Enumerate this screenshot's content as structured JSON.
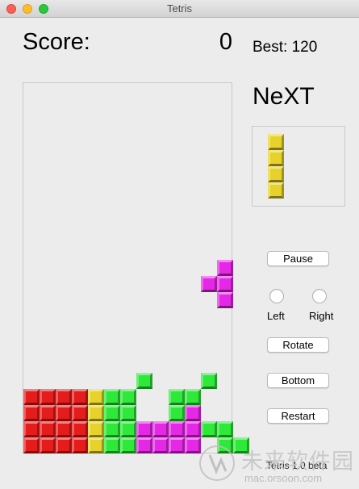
{
  "window": {
    "title": "Tetris"
  },
  "score": {
    "label": "Score:",
    "value": "0",
    "best": "Best: 120"
  },
  "next": {
    "title": "NeXT",
    "piece": {
      "color": "#e6d22a",
      "cells": [
        [
          0,
          0
        ],
        [
          0,
          1
        ],
        [
          0,
          2
        ],
        [
          0,
          3
        ]
      ]
    }
  },
  "controls": {
    "pause": "Pause",
    "left": "Left",
    "right": "Right",
    "rotate": "Rotate",
    "bottom": "Bottom",
    "restart": "Restart"
  },
  "footer": {
    "text": "Tetris 1.0 beta"
  },
  "watermark": {
    "site_name": "未来软件园",
    "url": "mac.orsoon.com"
  },
  "board": {
    "columns": 13,
    "rows": 23,
    "colors": {
      "R": "#e41c1c",
      "Y": "#e6d22a",
      "G": "#2ee83a",
      "M": "#e528e6"
    },
    "grid": [
      ".............",
      ".............",
      ".............",
      ".............",
      ".............",
      ".............",
      ".............",
      ".............",
      ".............",
      ".............",
      ".............",
      "............M",
      "...........MM",
      "............M",
      ".............",
      ".............",
      ".............",
      ".............",
      ".......G...G.",
      "RRRRYGG..GG..",
      "RRRRYGG..GM..",
      "RRRRYGGMMMMGG",
      "RRRRYGGMMMM.GG"
    ]
  }
}
